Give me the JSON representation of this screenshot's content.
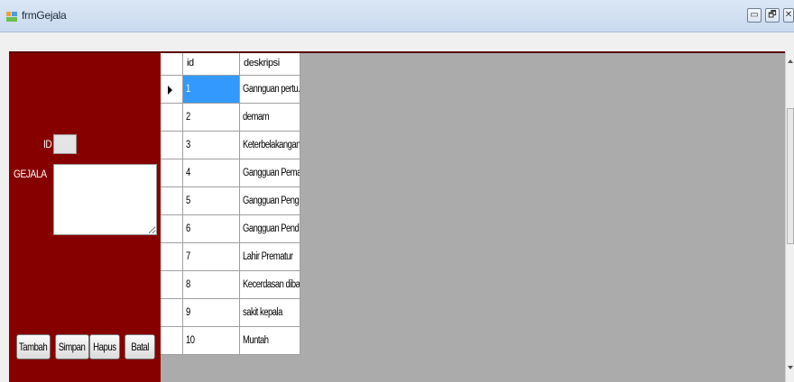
{
  "window": {
    "title": "frmGejala",
    "controls": {
      "minimize": "▭",
      "restore": "🗗",
      "close": "✕"
    }
  },
  "form": {
    "id_label": "ID",
    "gejala_label": "GEJALA",
    "id_value": "",
    "gejala_value": ""
  },
  "buttons": {
    "tambah": "Tambah",
    "simpan": "Simpan",
    "hapus": "Hapus",
    "batal": "Batal"
  },
  "grid": {
    "columns": [
      "id",
      "deskripsi"
    ],
    "rows": [
      {
        "id": "1",
        "deskripsi": "Gannguan pertu..."
      },
      {
        "id": "2",
        "deskripsi": "demam"
      },
      {
        "id": "3",
        "deskripsi": "Keterbelakangan..."
      },
      {
        "id": "4",
        "deskripsi": "Gangguan Pema..."
      },
      {
        "id": "5",
        "deskripsi": "Gangguan Peng..."
      },
      {
        "id": "6",
        "deskripsi": "Gangguan Pend..."
      },
      {
        "id": "7",
        "deskripsi": "Lahir Prematur"
      },
      {
        "id": "8",
        "deskripsi": "Kecerdasan diba..."
      },
      {
        "id": "9",
        "deskripsi": "sakit kepala"
      },
      {
        "id": "10",
        "deskripsi": "Muntah"
      }
    ],
    "selected_row": 0
  },
  "colors": {
    "panel": "#870000",
    "grid_bg": "#ababab",
    "selection": "#3399ff"
  }
}
